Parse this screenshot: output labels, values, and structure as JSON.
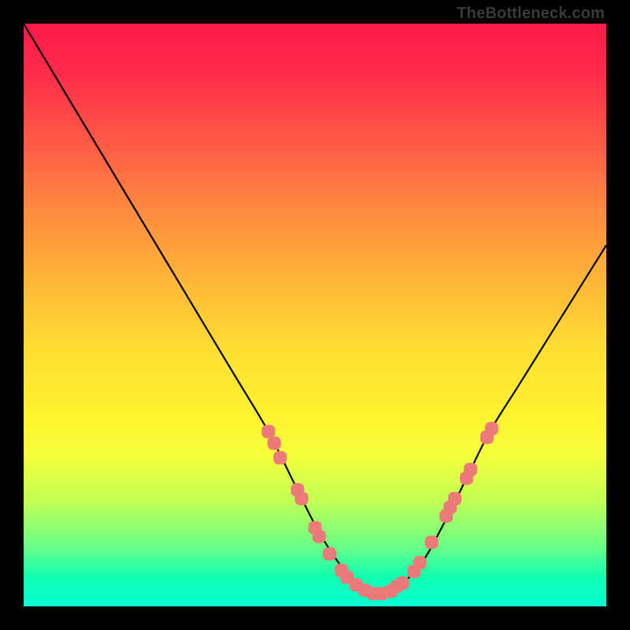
{
  "attribution": "TheBottleneck.com",
  "colors": {
    "background": "#000000",
    "curve": "#000000",
    "marker_fill": "#ec7a78",
    "marker_stroke": "#ec7a78",
    "bottom_line": "#00ffc1",
    "gradient_top": "#ff1a4a",
    "gradient_bottom": "#08ffd8"
  },
  "chart_data": {
    "type": "line",
    "title": "",
    "xlabel": "",
    "ylabel": "",
    "xlim": [
      0,
      100
    ],
    "ylim": [
      0,
      100
    ],
    "bottom_line_y": 1.5,
    "series": [
      {
        "name": "curve",
        "x": [
          0,
          6,
          12,
          18,
          24,
          30,
          36,
          42,
          46,
          50,
          53,
          56,
          58,
          60,
          62,
          64,
          68,
          72,
          76,
          80,
          85,
          90,
          95,
          100
        ],
        "y": [
          100,
          90,
          80,
          70,
          60,
          50,
          40,
          30,
          22,
          14,
          9,
          5,
          3.2,
          2.2,
          2.2,
          3.2,
          7,
          14,
          22,
          30,
          38,
          46,
          54,
          62
        ]
      }
    ],
    "markers": [
      {
        "x": 42.0,
        "y": 30.0
      },
      {
        "x": 43.0,
        "y": 28.0
      },
      {
        "x": 44.0,
        "y": 25.5
      },
      {
        "x": 47.0,
        "y": 20.0
      },
      {
        "x": 47.7,
        "y": 18.5
      },
      {
        "x": 50.0,
        "y": 13.5
      },
      {
        "x": 50.7,
        "y": 12.0
      },
      {
        "x": 52.5,
        "y": 9.0
      },
      {
        "x": 54.5,
        "y": 6.2
      },
      {
        "x": 55.5,
        "y": 5.0
      },
      {
        "x": 57.0,
        "y": 3.7
      },
      {
        "x": 58.5,
        "y": 2.8
      },
      {
        "x": 60.0,
        "y": 2.2
      },
      {
        "x": 61.5,
        "y": 2.2
      },
      {
        "x": 63.0,
        "y": 2.6
      },
      {
        "x": 64.0,
        "y": 3.4
      },
      {
        "x": 65.0,
        "y": 4.0
      },
      {
        "x": 67.0,
        "y": 6.0
      },
      {
        "x": 68.0,
        "y": 7.5
      },
      {
        "x": 70.0,
        "y": 11.0
      },
      {
        "x": 72.5,
        "y": 15.5
      },
      {
        "x": 73.2,
        "y": 17.0
      },
      {
        "x": 74.0,
        "y": 18.5
      },
      {
        "x": 76.0,
        "y": 22.0
      },
      {
        "x": 76.7,
        "y": 23.5
      },
      {
        "x": 79.5,
        "y": 29.0
      },
      {
        "x": 80.3,
        "y": 30.5
      }
    ]
  }
}
